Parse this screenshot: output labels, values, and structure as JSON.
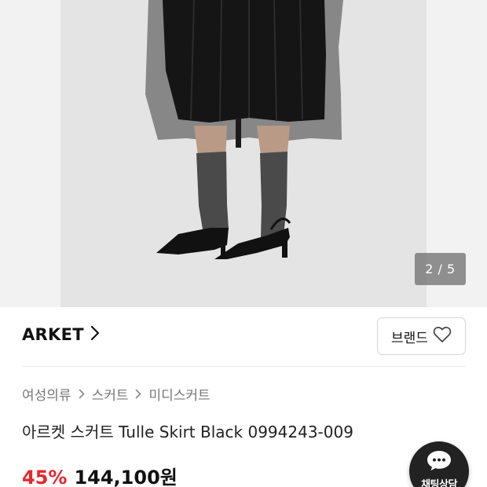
{
  "gallery": {
    "image_alt": "",
    "counter_current": "2",
    "counter_total": "5",
    "counter_text": "2 / 5"
  },
  "brand": {
    "name": "ARKET",
    "button_label": "브랜드"
  },
  "breadcrumb": [
    "여성의류",
    "스커트",
    "미디스커트"
  ],
  "product": {
    "title": "아르켓 스커트 Tulle Skirt Black 0994243-009",
    "discount": "45%",
    "price": "144,100원"
  },
  "chat": {
    "label": "채팅상담"
  },
  "colors": {
    "accent_red": "#e8262e",
    "fab_bg": "#222222"
  },
  "icons": [
    "chevron-right-icon",
    "heart-outline-icon",
    "chat-bubble-icon"
  ]
}
